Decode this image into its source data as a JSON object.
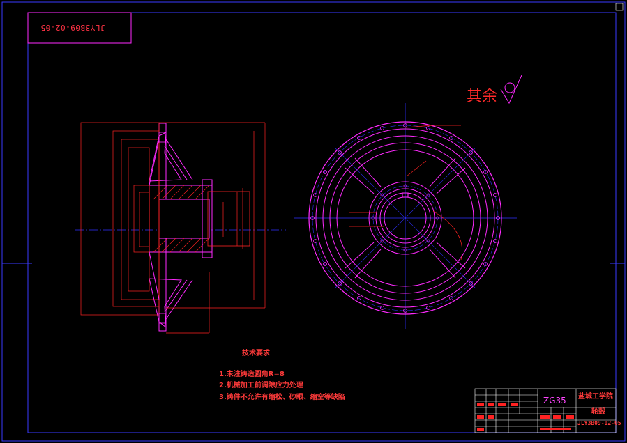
{
  "drawing_code_rotated": "JLY3B09-02-05",
  "surface_note": "其余",
  "technical_requirements": {
    "title": "技术要求",
    "items": [
      "1.未注铸造圆角R=8",
      "2.机械加工前调除应力处理",
      "3.铸件不允许有缩松、砂眼、缩空等缺陷"
    ]
  },
  "title_block": {
    "material": "ZG35",
    "school": "盐城工学院",
    "part_name": "轮毂",
    "drawing_number": "JLY3B09-02-05"
  },
  "colors": {
    "frame": "#3a3aff",
    "outline": "#ff2aff",
    "dimension": "#ff2222",
    "centerline": "#2f2fff",
    "hatch": "#ff2222"
  }
}
